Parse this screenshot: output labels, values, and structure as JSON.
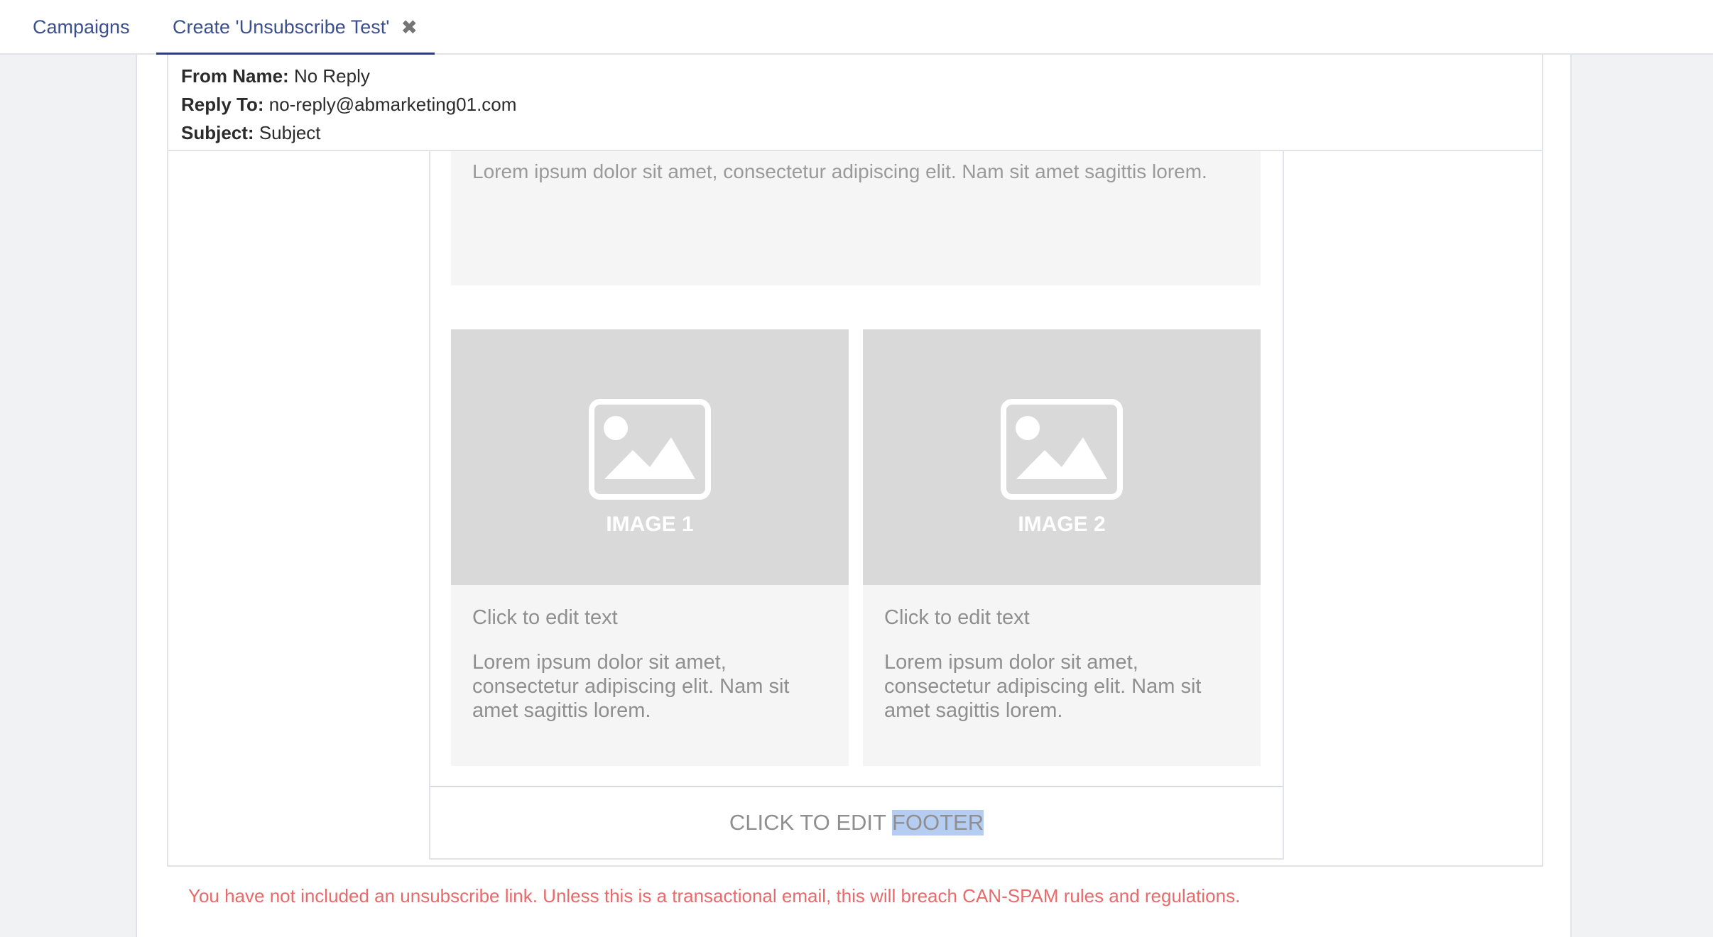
{
  "tabs": [
    {
      "label": "Campaigns"
    },
    {
      "label": "Create 'Unsubscribe Test'",
      "close_icon": "✖"
    }
  ],
  "meta": {
    "from_name_label": "From Name:",
    "from_name_value": "No Reply",
    "reply_to_label": "Reply To:",
    "reply_to_value": "no-reply@abmarketing01.com",
    "subject_label": "Subject:",
    "subject_value": "Subject"
  },
  "email": {
    "top_text": "Lorem ipsum dolor sit amet, consectetur adipiscing elit. Nam sit amet sagittis lorem.",
    "columns": [
      {
        "image_label": "IMAGE 1",
        "heading": "Click to edit text",
        "body": "Lorem ipsum dolor sit amet, consectetur adipiscing elit. Nam sit amet sagittis lorem."
      },
      {
        "image_label": "IMAGE 2",
        "heading": "Click to edit text",
        "body": "Lorem ipsum dolor sit amet, consectetur adipiscing elit. Nam sit amet sagittis lorem."
      }
    ],
    "footer_prefix": "CLICK TO EDIT",
    "footer_highlight": "FOOTER"
  },
  "warning": "You have not included an unsubscribe link. Unless this is a transactional email, this will breach CAN-SPAM rules and regulations.",
  "colors": {
    "accent": "#2d3d80",
    "tab_text": "#3c4f8d",
    "warning": "#e86a6a",
    "selection": "#b6cdf2"
  },
  "icons": {
    "tab_close": "close-icon",
    "image_placeholder": "image-placeholder-icon"
  }
}
